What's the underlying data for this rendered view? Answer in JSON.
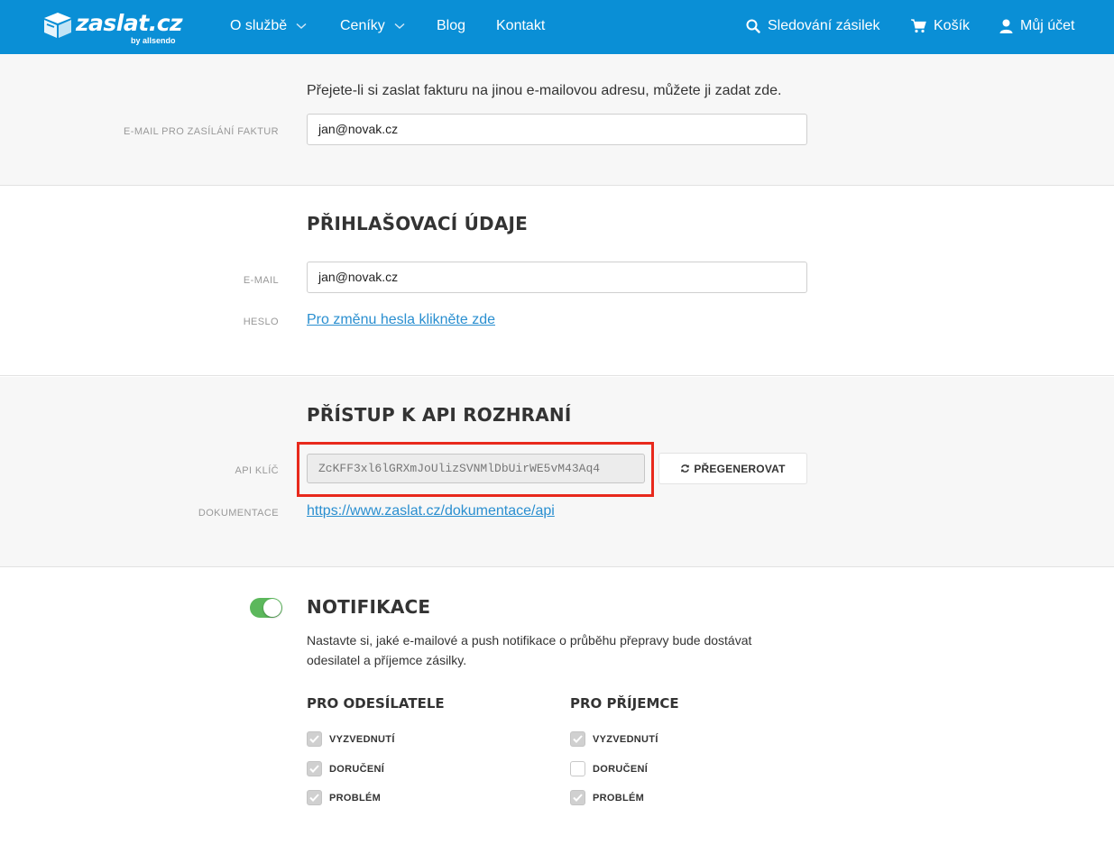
{
  "header": {
    "logo_text": "zaslat.cz",
    "logo_sub": "by allsendo",
    "nav": [
      {
        "label": "O službě",
        "dropdown": true
      },
      {
        "label": "Ceníky",
        "dropdown": true
      },
      {
        "label": "Blog",
        "dropdown": false
      },
      {
        "label": "Kontakt",
        "dropdown": false
      }
    ],
    "right": [
      {
        "label": "Sledování zásilek",
        "icon": "search-icon"
      },
      {
        "label": "Košík",
        "icon": "cart-icon"
      },
      {
        "label": "Můj účet",
        "icon": "user-icon"
      }
    ],
    "bg_color": "#0a8fd6"
  },
  "invoice": {
    "description": "Přejete-li si zaslat fakturu na jinou e-mailovou adresu, můžete ji zadat zde.",
    "email_label": "E-MAIL PRO ZASÍLÁNÍ FAKTUR",
    "email_value": "jan@novak.cz"
  },
  "login": {
    "heading": "PŘIHLAŠOVACÍ ÚDAJE",
    "email_label": "E-MAIL",
    "email_value": "jan@novak.cz",
    "password_label": "HESLO",
    "password_link": "Pro změnu hesla klikněte zde"
  },
  "api": {
    "heading": "PŘÍSTUP K API ROZHRANÍ",
    "key_label": "API KLÍČ",
    "key_value": "ZcKFF3xl6lGRXmJoUlizSVNMlDbUirWE5vM43Aq4",
    "regenerate_label": "PŘEGENEROVAT",
    "docs_label": "DOKUMENTACE",
    "docs_link": "https://www.zaslat.cz/dokumentace/api",
    "highlight_color": "#e8291c"
  },
  "notifications": {
    "enabled": true,
    "heading": "NOTIFIKACE",
    "description_line1": "Nastavte si, jaké e-mailové a push notifikace o průběhu přepravy bude dostávat",
    "description_line2": "odesilatel a příjemce zásilky.",
    "sender": {
      "heading": "PRO ODESÍLATELE",
      "items": [
        {
          "label": "VYZVEDNUTÍ",
          "checked": true
        },
        {
          "label": "DORUČENÍ",
          "checked": true
        },
        {
          "label": "PROBLÉM",
          "checked": true
        }
      ]
    },
    "recipient": {
      "heading": "PRO PŘÍJEMCE",
      "items": [
        {
          "label": "VYZVEDNUTÍ",
          "checked": true
        },
        {
          "label": "DORUČENÍ",
          "checked": false
        },
        {
          "label": "PROBLÉM",
          "checked": true
        }
      ]
    },
    "toggle_color": "#5cb85c"
  }
}
